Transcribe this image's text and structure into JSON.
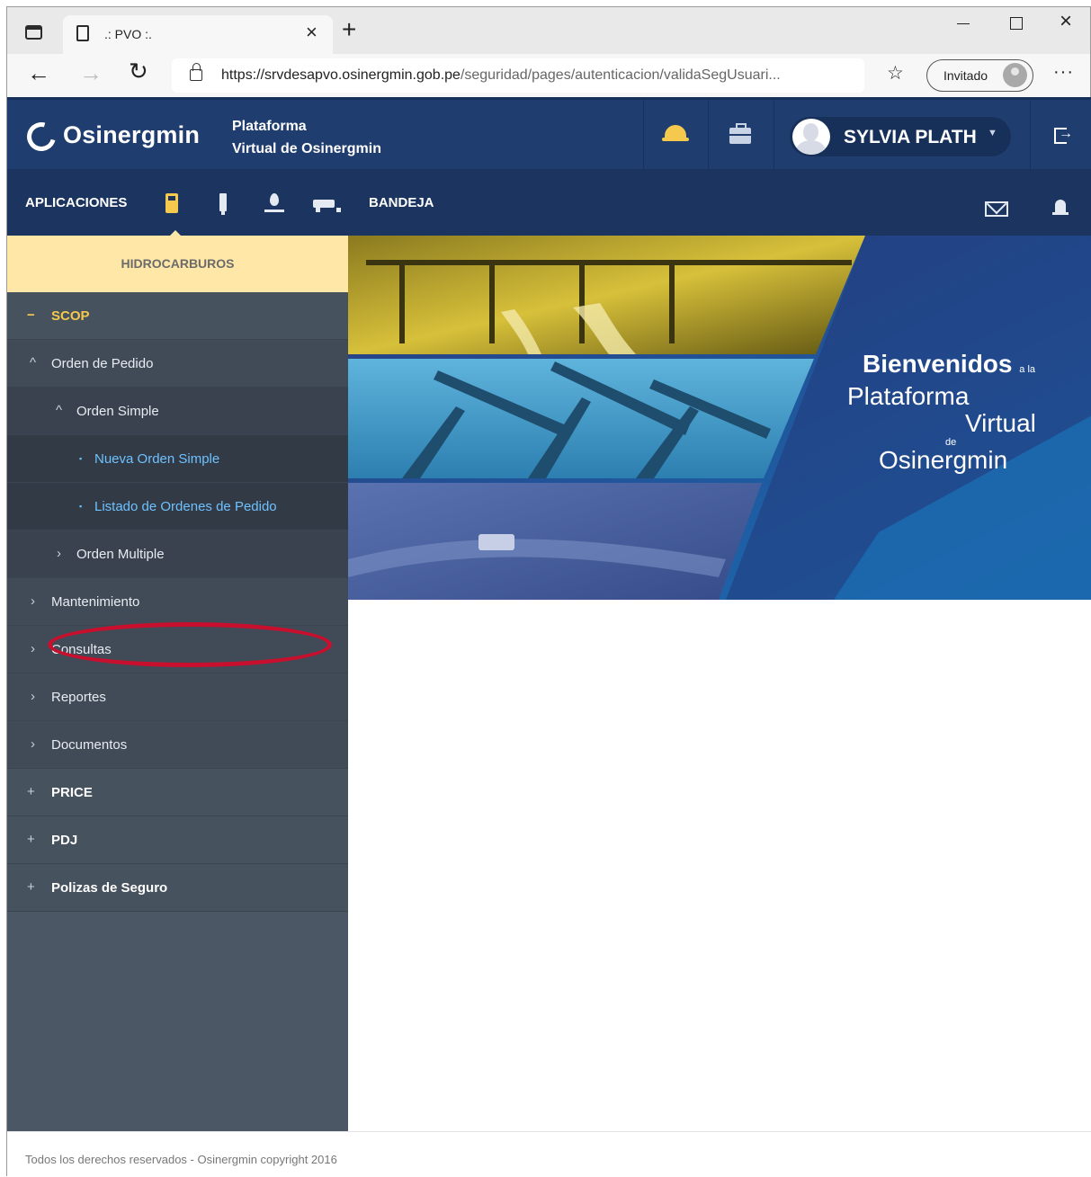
{
  "browser": {
    "tab_title": ".: PVO :.",
    "url_main": "https://srvdesapvo.osinergmin.gob.pe",
    "url_rest": "/seguridad/pages/autenticacion/validaSegUsuari...",
    "profile_label": "Invitado"
  },
  "header": {
    "logo_text": "Osinergmin",
    "platform_line1": "Plataforma",
    "platform_line2": "Virtual de Osinergmin",
    "user_name": "SYLVIA PLATH"
  },
  "navbar": {
    "apps_label": "APLICACIONES",
    "bandeja_label": "BANDEJA",
    "app_icons": [
      "fuel-icon",
      "electricity-icon",
      "gas-icon",
      "mining-icon"
    ]
  },
  "sidebar": {
    "section_title": "HIDROCARBUROS",
    "items": [
      {
        "icon": "−",
        "label": "SCOP"
      },
      {
        "icon": "^",
        "label": "Orden de Pedido"
      },
      {
        "icon": "^",
        "label": "Orden Simple"
      },
      {
        "icon": "▪",
        "label": "Nueva Orden Simple"
      },
      {
        "icon": "▪",
        "label": "Listado de Ordenes de Pedido"
      },
      {
        "icon": "›",
        "label": "Orden Multiple"
      },
      {
        "icon": "›",
        "label": "Mantenimiento"
      },
      {
        "icon": "›",
        "label": "Consultas"
      },
      {
        "icon": "›",
        "label": "Reportes"
      },
      {
        "icon": "›",
        "label": "Documentos"
      },
      {
        "icon": "+",
        "label": "PRICE"
      },
      {
        "icon": "+",
        "label": "PDJ"
      },
      {
        "icon": "+",
        "label": "Polizas de Seguro"
      }
    ]
  },
  "banner": {
    "word1": "Bienvenidos",
    "small1": "a la",
    "word2": "Plataforma",
    "word3": "Virtual",
    "small2": "de",
    "word4": "Osinergmin"
  },
  "footer": {
    "text": "Todos los derechos reservados - Osinergmin copyright 2016"
  },
  "colors": {
    "header_bg": "#1f3d6f",
    "sidebar_bg": "#4c5766",
    "section_head_bg": "#ffe7a8",
    "scop_accent": "#f5c94d",
    "leaf_link": "#6ec1ff",
    "highlight": "#c8102e"
  }
}
